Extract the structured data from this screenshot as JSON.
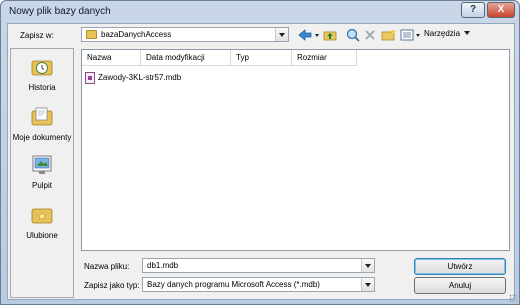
{
  "window": {
    "title": "Nowy plik bazy danych",
    "help_label": "?",
    "close_label": "X"
  },
  "save_in": {
    "label": "Zapisz w:",
    "folder": "bazaDanychAccess"
  },
  "toolbar": {
    "tools_label": "Narzędzia"
  },
  "places": [
    {
      "label": "Historia",
      "icon": "history-icon"
    },
    {
      "label": "Moje dokumenty",
      "icon": "my-documents-icon"
    },
    {
      "label": "Pulpit",
      "icon": "desktop-icon"
    },
    {
      "label": "Ulubione",
      "icon": "favorites-icon"
    }
  ],
  "list": {
    "columns": [
      "Nazwa",
      "Data modyfikacji",
      "Typ",
      "Rozmiar"
    ],
    "files": [
      {
        "name": "Zawody-3KL-str57.mdb",
        "icon": "access-db-icon"
      }
    ]
  },
  "file_name": {
    "label": "Nazwa pliku:",
    "value": "db1.mdb"
  },
  "save_as_type": {
    "label": "Zapisz jako typ:",
    "value": "Bazy danych programu Microsoft Access (*.mdb)"
  },
  "buttons": {
    "create": "Utwórz",
    "cancel": "Anuluj"
  }
}
